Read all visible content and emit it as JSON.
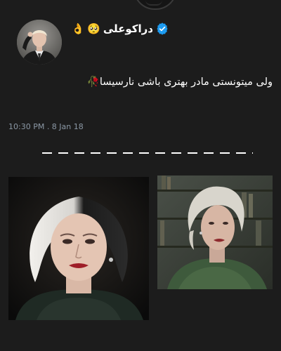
{
  "tweet": {
    "display_name": "دراکوعلی",
    "name_emojis": [
      "🥺",
      "👌"
    ],
    "text": "ولی میتونستی مادر بهتری باشی نارسیسا🥀",
    "timestamp": "10:30 PM . 8 Jan 18"
  },
  "icons": {
    "verified": "verified-badge-icon",
    "avatar": "avatar-photo"
  },
  "colors": {
    "background": "#1c1c1c",
    "text": "#ffffff",
    "secondary_text": "#8b98a5",
    "verified_blue": "#1d9bf0",
    "divider_dashes": "#ffffff"
  },
  "images": [
    {
      "name": "portrait-left",
      "description_key": "portrait"
    },
    {
      "name": "portrait-right",
      "description_key": "portrait"
    }
  ]
}
